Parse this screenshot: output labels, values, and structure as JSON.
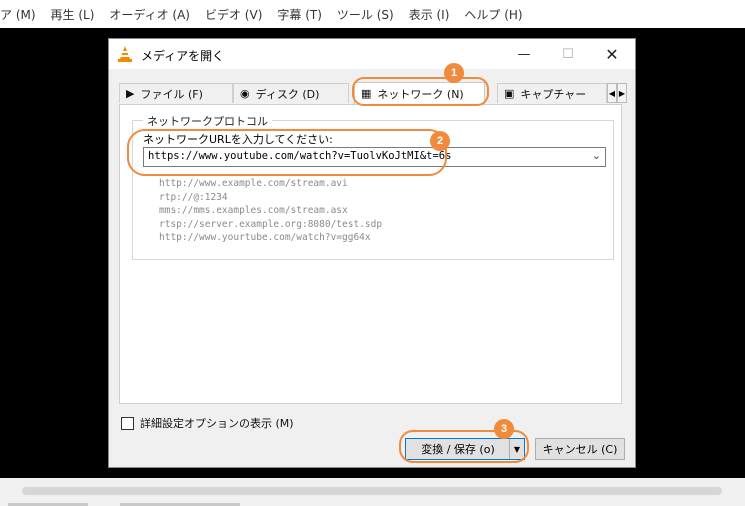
{
  "menubar": {
    "items": [
      "ア (M)",
      "再生 (L)",
      "オーディオ (A)",
      "ビデオ (V)",
      "字幕 (T)",
      "ツール (S)",
      "表示 (I)",
      "ヘルプ (H)"
    ]
  },
  "dialog": {
    "title": "メディアを開く",
    "icons": {
      "app": "vlc-cone-icon",
      "minimize": "minimize-icon",
      "maximize": "maximize-icon",
      "close": "close-icon"
    }
  },
  "tabs": [
    {
      "label": "ファイル (F)",
      "icon": "file-icon",
      "active": false
    },
    {
      "label": "ディスク (D)",
      "icon": "disc-icon",
      "active": false
    },
    {
      "label": "ネットワーク (N)",
      "icon": "network-icon",
      "active": true
    },
    {
      "label": "キャプチャー",
      "icon": "capture-icon",
      "active": false
    }
  ],
  "network": {
    "group_label": "ネットワークプロトコル",
    "url_label": "ネットワークURLを入力してください:",
    "url_value": "https://www.youtube.com/watch?v=TuolvKoJtMI&t=6s",
    "examples": [
      "http://www.example.com/stream.avi",
      "rtp://@:1234",
      "mms://mms.examples.com/stream.asx",
      "rtsp://server.example.org:8080/test.sdp",
      "http://www.yourtube.com/watch?v=gg64x"
    ]
  },
  "options": {
    "show_more_label": "詳細設定オプションの表示 (M)",
    "show_more_checked": false
  },
  "buttons": {
    "convert_label": "変換 / 保存 (o)",
    "cancel_label": "キャンセル (C)"
  },
  "annotations": [
    "1",
    "2",
    "3"
  ],
  "colors": {
    "highlight": "#f08a3c",
    "focus": "#0078d7"
  }
}
